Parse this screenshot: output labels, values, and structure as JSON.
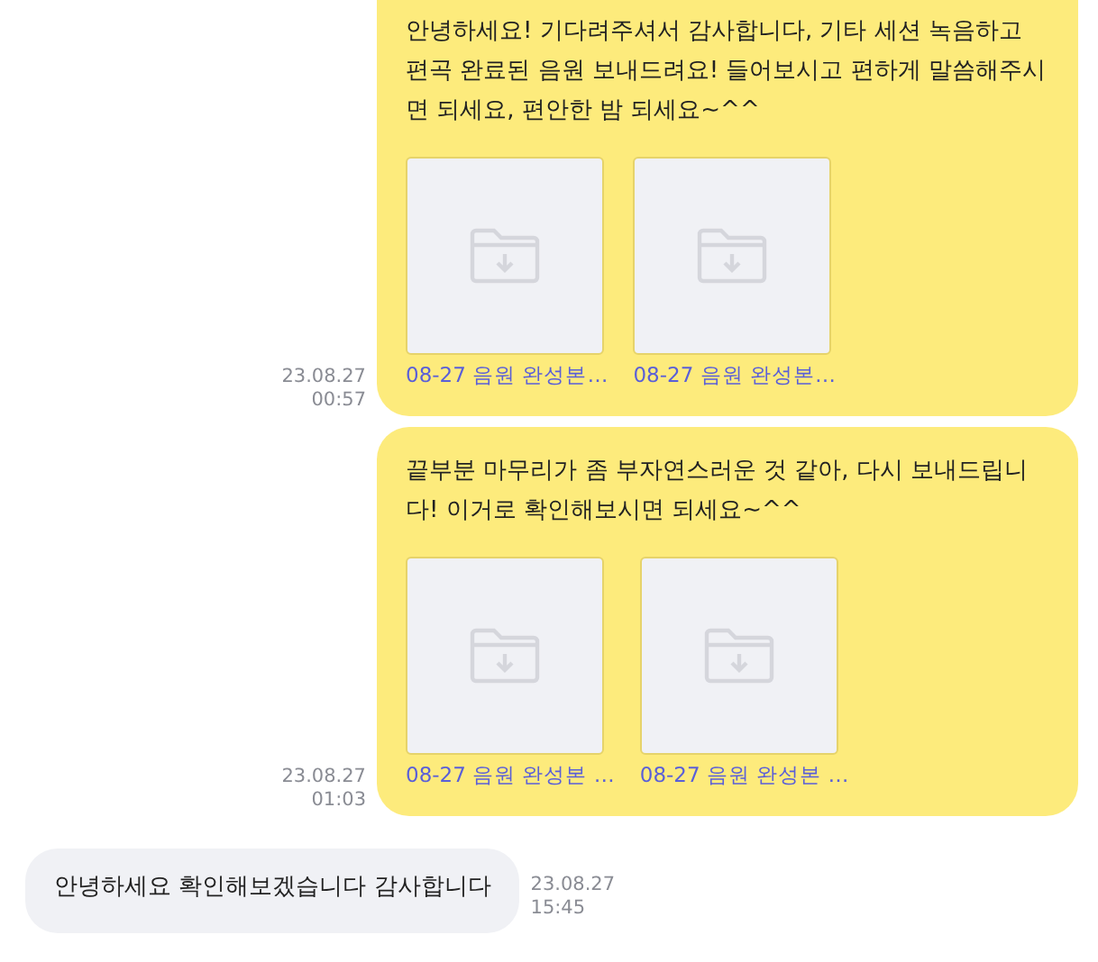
{
  "messages": [
    {
      "kind": "sent",
      "text": "안녕하세요! 기다려주셔서 감사합니다, 기타 세션 녹음하고 편곡 완료된 음원 보내드려요! 들어보시고 편하게 말씀해주시면 되세요, 편안한 밤 되세요~^^",
      "attachments": [
        {
          "name": "08-27 음원 완성본…"
        },
        {
          "name": "08-27 음원 완성본…"
        }
      ],
      "date": "23.08.27",
      "time": "00:57"
    },
    {
      "kind": "sent",
      "text": "끝부분 마무리가 좀 부자연스러운 것 같아, 다시 보내드립니다! 이거로 확인해보시면 되세요~^^",
      "attachments": [
        {
          "name": "08-27 음원 완성본 …"
        },
        {
          "name": "08-27 음원 완성본 …"
        }
      ],
      "date": "23.08.27",
      "time": "01:03"
    },
    {
      "kind": "received",
      "text": "안녕하세요 확인해보겠습니다 감사합니다",
      "date": "23.08.27",
      "time": "15:45"
    }
  ]
}
